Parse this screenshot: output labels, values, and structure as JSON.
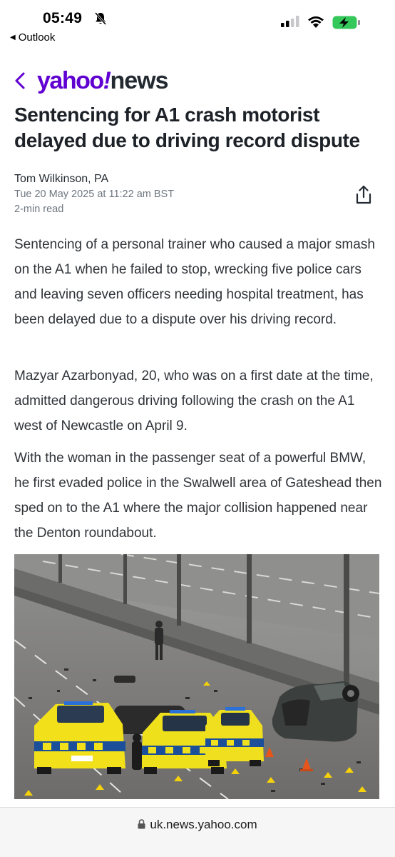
{
  "status_bar": {
    "time": "05:49",
    "back_app": "Outlook",
    "battery_color": "#34c759"
  },
  "header": {
    "logo_yahoo": "yahoo",
    "logo_bang": "!",
    "logo_news": "news",
    "brand_color": "#6001d2"
  },
  "article": {
    "headline": "Sentencing for A1 crash motorist delayed due to driving record dispute",
    "author": "Tom Wilkinson, PA",
    "date": "Tue 20 May 2025 at 11:22 am BST",
    "read_time": "2-min read",
    "paragraphs": [
      "Sentencing of a personal trainer who caused a major smash on the A1 when he failed to stop, wrecking five police cars and leaving seven officers needing hospital treatment, has been delayed due to a dispute over his driving record.",
      "Mazyar Azarbonyad, 20, who was on a first date at the time, admitted dangerous driving following the crash on the A1 west of Newcastle on April 9.",
      "With the woman in the passenger seat of a powerful BMW, he first evaded police in the Swalwell area of Gateshead then sped on to the A1 where the major collision happened near the Denton roundabout."
    ],
    "photo_icons": [
      "police-car-icon",
      "crashed-car-icon",
      "traffic-cone-icon",
      "evidence-marker-icon",
      "person-icon"
    ]
  },
  "url_bar": {
    "url": "uk.news.yahoo.com"
  }
}
